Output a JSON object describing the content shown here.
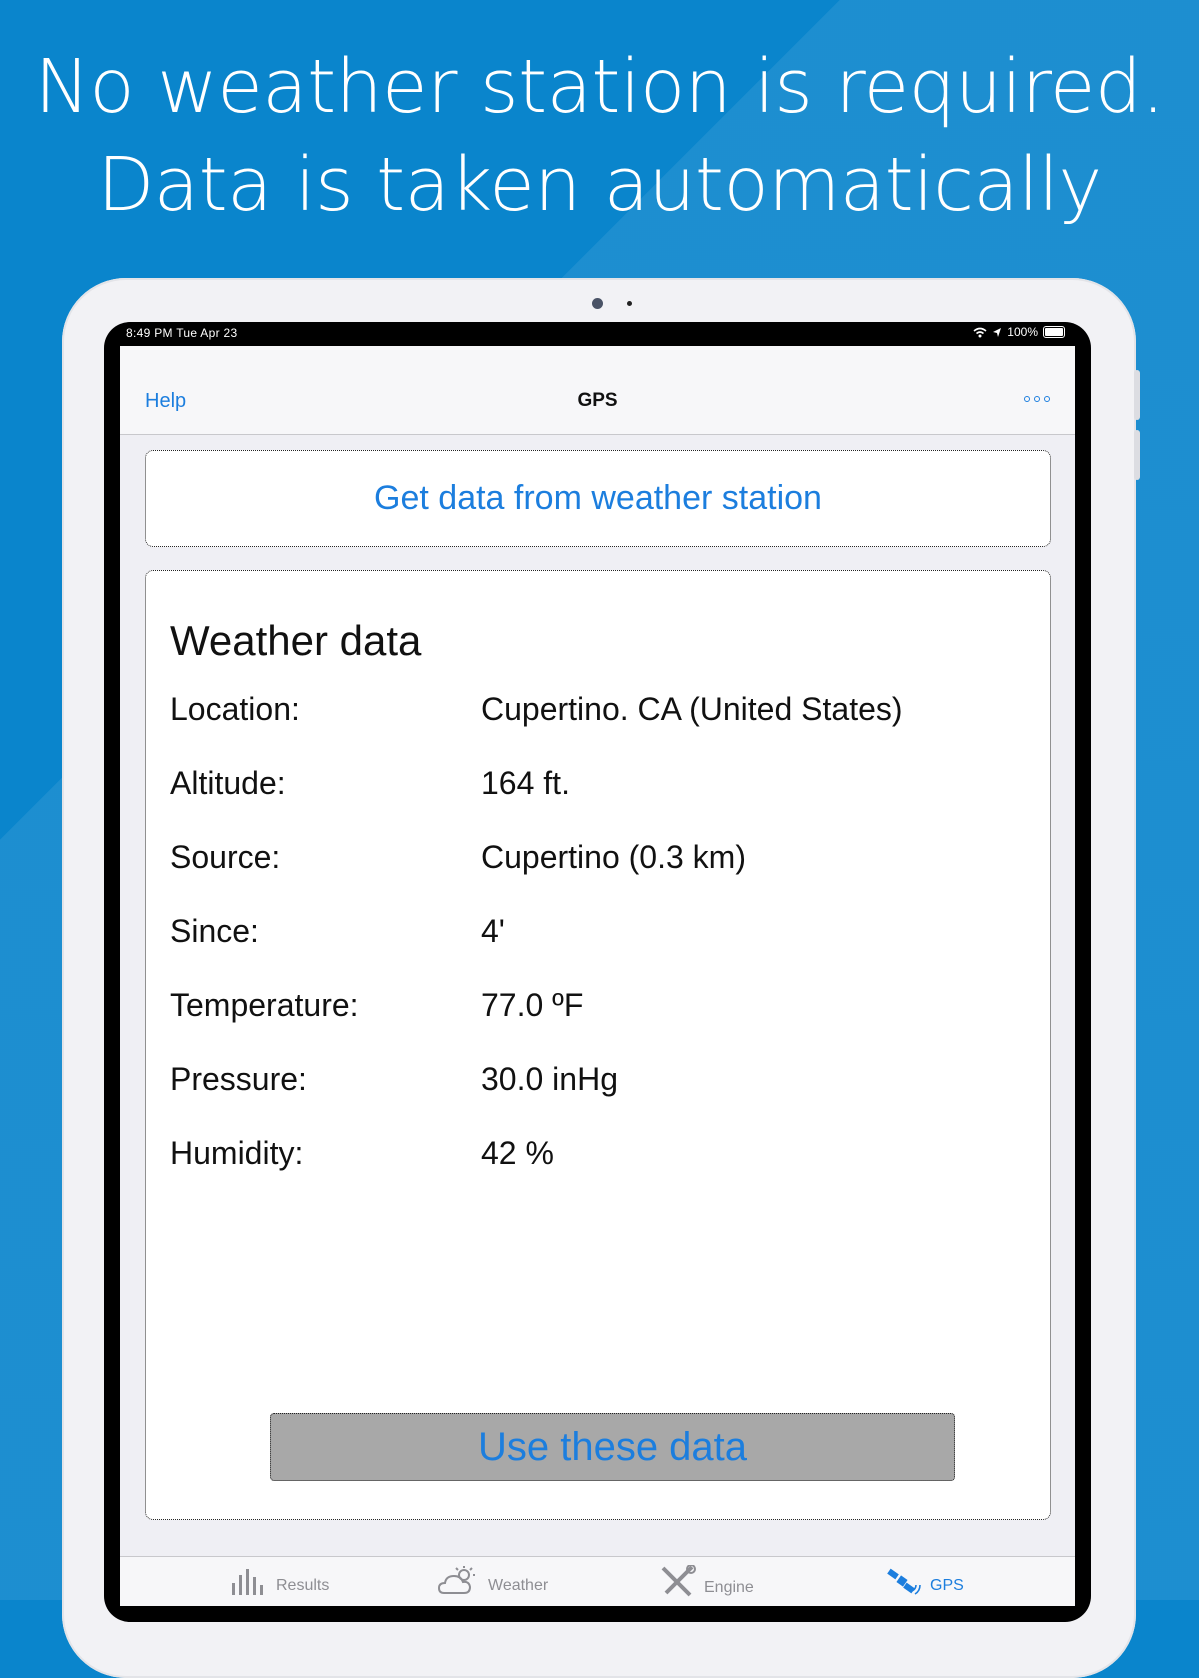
{
  "headline": {
    "line1": "No weather station is required.",
    "line2": "Data is taken automatically"
  },
  "statusbar": {
    "time_date": "8:49 PM   Tue Apr 23",
    "battery": "100%",
    "icons": [
      "wifi-icon",
      "location-arrow-icon",
      "battery-icon"
    ]
  },
  "navbar": {
    "left": "Help",
    "title": "GPS",
    "right_icon": "more-icon"
  },
  "get_button": "Get data from weather station",
  "weather": {
    "title": "Weather data",
    "rows": [
      {
        "label": "Location:",
        "value": "Cupertino. CA (United States)"
      },
      {
        "label": "Altitude:",
        "value": "164 ft."
      },
      {
        "label": "Source:",
        "value": "Cupertino (0.3 km)"
      },
      {
        "label": "Since:",
        "value": "4'"
      },
      {
        "label": "Temperature:",
        "value": "77.0 ºF"
      },
      {
        "label": "Pressure:",
        "value": "30.0 inHg"
      },
      {
        "label": "Humidity:",
        "value": "42 %"
      }
    ],
    "use_button": "Use these data"
  },
  "tabs": [
    {
      "label": "Results",
      "icon": "bar-chart-icon",
      "active": false
    },
    {
      "label": "Weather",
      "icon": "cloud-sun-icon",
      "active": false
    },
    {
      "label": "Engine",
      "icon": "tools-icon",
      "active": false
    },
    {
      "label": "GPS",
      "icon": "satellite-icon",
      "active": true
    }
  ],
  "colors": {
    "background": "#0a85cc",
    "accent": "#1c7ede",
    "use_button_bg": "#a8a8a8"
  }
}
